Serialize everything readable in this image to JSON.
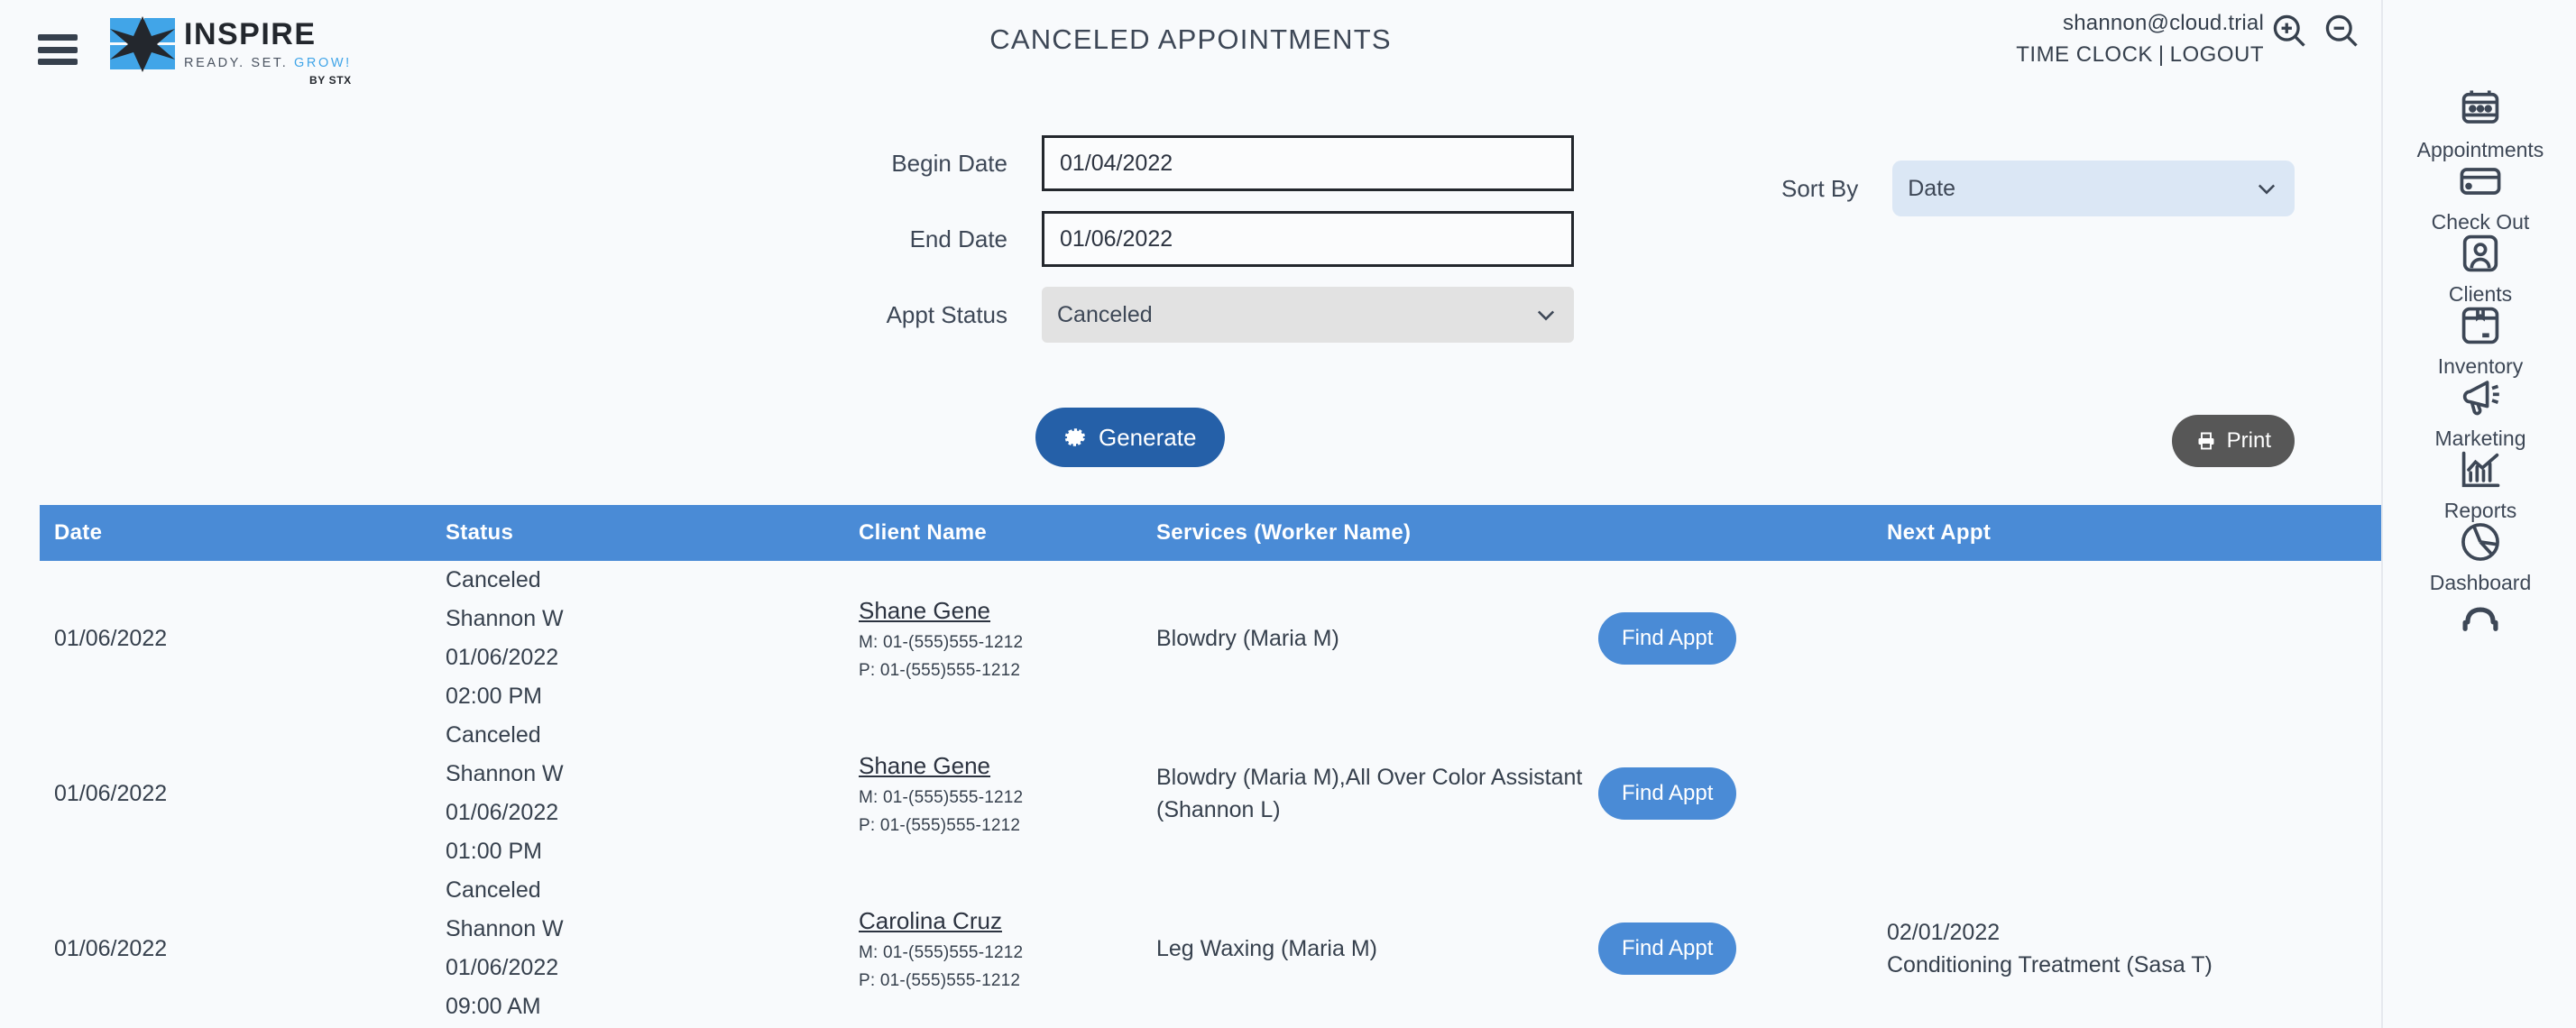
{
  "brand": {
    "name": "INSPIRE",
    "tagline_ready": "READY. SET. ",
    "tagline_grow": "GROW!",
    "by": "BY STX",
    "accent": "#41a5e8"
  },
  "header": {
    "title": "CANCELED  APPOINTMENTS",
    "email": "shannon@cloud.trial",
    "time_clock": "TIME CLOCK",
    "separator": "|",
    "logout": "LOGOUT"
  },
  "form": {
    "begin_date_label": "Begin Date",
    "begin_date_value": "01/04/2022",
    "end_date_label": "End Date",
    "end_date_value": "01/06/2022",
    "appt_status_label": "Appt Status",
    "appt_status_value": "Canceled",
    "sort_by_label": "Sort By",
    "sort_by_value": "Date",
    "generate_label": "Generate",
    "print_label": "Print"
  },
  "table": {
    "columns": [
      "Date",
      "Status",
      "Client Name",
      "Services (Worker Name)",
      "Next Appt"
    ],
    "header_color": "#4a8bd6",
    "find_appt_label": "Find Appt",
    "rows": [
      {
        "date": "01/06/2022",
        "status": "Canceled\nShannon W\n01/06/2022\n02:00 PM",
        "client_name": "Shane Gene",
        "client_mobile": "M: 01-(555)555-1212",
        "client_phone": "P: 01-(555)555-1212",
        "services": "Blowdry (Maria M)",
        "next_appt": ""
      },
      {
        "date": "01/06/2022",
        "status": "Canceled\nShannon W\n01/06/2022\n01:00 PM",
        "client_name": "Shane Gene",
        "client_mobile": "M: 01-(555)555-1212",
        "client_phone": "P: 01-(555)555-1212",
        "services": "Blowdry (Maria M),All Over Color Assistant (Shannon L)",
        "next_appt": ""
      },
      {
        "date": "01/06/2022",
        "status": "Canceled\nShannon W\n01/06/2022\n09:00 AM",
        "client_name": "Carolina Cruz",
        "client_mobile": "M: 01-(555)555-1212",
        "client_phone": "P: 01-(555)555-1212",
        "services": "Leg Waxing (Maria M)",
        "next_appt": "02/01/2022\nConditioning Treatment (Sasa T)"
      }
    ]
  },
  "rail": {
    "items": [
      {
        "label": "Appointments",
        "icon": "calendar-icon"
      },
      {
        "label": "Check Out",
        "icon": "credit-card-icon"
      },
      {
        "label": "Clients",
        "icon": "contact-card-icon"
      },
      {
        "label": "Inventory",
        "icon": "box-icon"
      },
      {
        "label": "Marketing",
        "icon": "megaphone-icon"
      },
      {
        "label": "Reports",
        "icon": "bar-chart-icon"
      },
      {
        "label": "Dashboard",
        "icon": "pie-chart-icon"
      }
    ]
  }
}
